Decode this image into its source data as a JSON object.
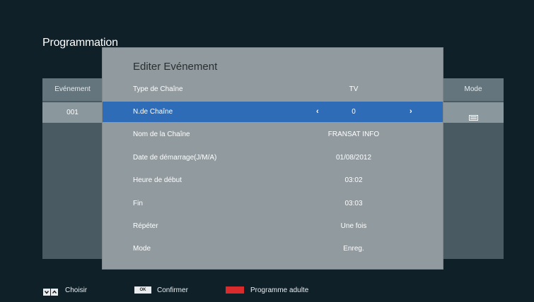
{
  "page_title": "Programmation",
  "list": {
    "headers": {
      "event": "Evénement",
      "mode": "Mode"
    },
    "rows": [
      {
        "event": "001",
        "mode_icon": "record-icon"
      }
    ]
  },
  "dialog": {
    "title": "Editer Evénement",
    "fields": [
      {
        "label": "Type de Chaîne",
        "value": "TV"
      },
      {
        "label": "N.de Chaîne",
        "value": "0",
        "left_arrow": "‹",
        "right_arrow": "›"
      },
      {
        "label": "Nom de la Chaîne",
        "value": "FRANSAT INFO"
      },
      {
        "label": "Date de démarrage(J/M/A)",
        "value": "01/08/2012"
      },
      {
        "label": "Heure de début",
        "value": "03:02"
      },
      {
        "label": "Fin",
        "value": "03:03"
      },
      {
        "label": "Répéter",
        "value": "Une fois"
      },
      {
        "label": "Mode",
        "value": "Enreg."
      }
    ]
  },
  "footer": {
    "choose": {
      "icon": "up-down-arrows-icon",
      "label": "Choisir"
    },
    "confirm": {
      "key_label": "OK",
      "label": "Confirmer"
    },
    "adult": {
      "color": "#d92b2b",
      "label": "Programme adulte"
    }
  },
  "colors": {
    "background": "#0f2029",
    "dialog": "#919a9f",
    "selected_row": "#2e6cb8",
    "list_panel": "#4a5a63",
    "red_key": "#d92b2b"
  }
}
